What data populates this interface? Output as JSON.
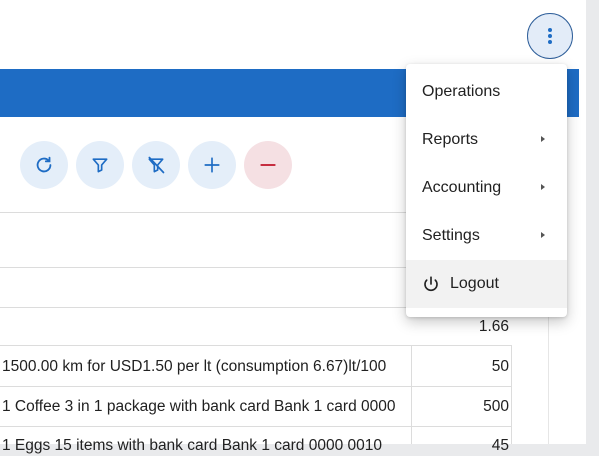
{
  "menu": {
    "items": [
      {
        "label": "Operations"
      },
      {
        "label": "Reports"
      },
      {
        "label": "Accounting"
      },
      {
        "label": "Settings"
      }
    ],
    "logout_label": "Logout"
  },
  "toolbar": {
    "buttons": [
      {
        "icon": "refresh-icon"
      },
      {
        "icon": "filter-icon"
      },
      {
        "icon": "clear-filter-icon"
      },
      {
        "icon": "plus-icon"
      },
      {
        "icon": "minus-icon"
      }
    ],
    "accent": "#1e6cc4"
  },
  "table": {
    "rows": [
      {
        "description": "",
        "value": "1.66"
      },
      {
        "description": "1500.00 km  for USD1.50 per lt (consumption 6.67)lt/100",
        "value": "50"
      },
      {
        "description": "1 Coffee 3 in 1 package  with bank card Bank 1 card 0000",
        "value": "500"
      },
      {
        "description": "1 Eggs 15 items  with bank card Bank 1 card 0000 0010",
        "value": "45"
      }
    ]
  }
}
